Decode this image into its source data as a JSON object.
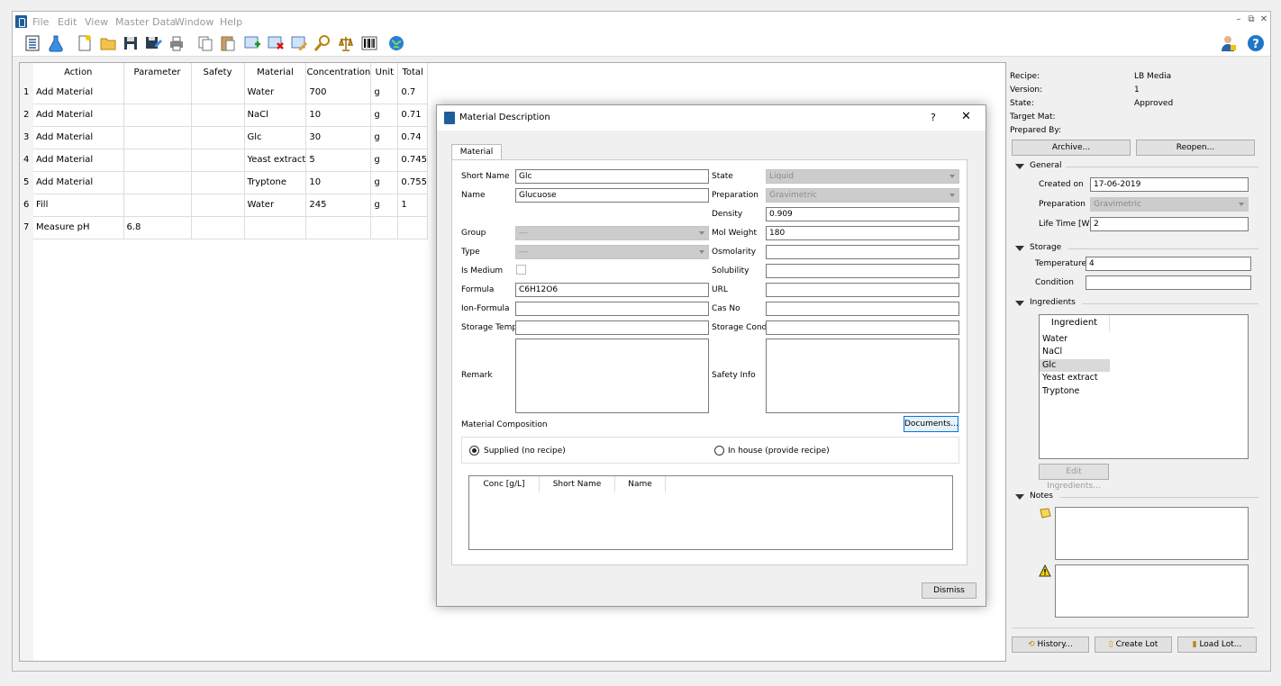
{
  "menu": [
    "File",
    "Edit",
    "View",
    "Master Data",
    "Window",
    "Help"
  ],
  "window_controls": {
    "minimize": "–",
    "restore": "⧉",
    "close": "✕"
  },
  "table": {
    "headers": [
      "Action",
      "Parameter",
      "Safety",
      "Material",
      "Concentration",
      "Unit",
      "Total"
    ],
    "rows": [
      {
        "n": "1",
        "action": "Add Material",
        "parameter": "",
        "safety": "",
        "material": "Water",
        "conc": "700",
        "unit": "g",
        "total": "0.7"
      },
      {
        "n": "2",
        "action": "Add Material",
        "parameter": "",
        "safety": "",
        "material": "NaCl",
        "conc": "10",
        "unit": "g",
        "total": "0.71"
      },
      {
        "n": "3",
        "action": "Add Material",
        "parameter": "",
        "safety": "",
        "material": "Glc",
        "conc": "30",
        "unit": "g",
        "total": "0.74"
      },
      {
        "n": "4",
        "action": "Add Material",
        "parameter": "",
        "safety": "",
        "material": "Yeast extract",
        "conc": "5",
        "unit": "g",
        "total": "0.745"
      },
      {
        "n": "5",
        "action": "Add Material",
        "parameter": "",
        "safety": "",
        "material": "Tryptone",
        "conc": "10",
        "unit": "g",
        "total": "0.755"
      },
      {
        "n": "6",
        "action": "Fill",
        "parameter": "",
        "safety": "",
        "material": "Water",
        "conc": "245",
        "unit": "g",
        "total": "1"
      },
      {
        "n": "7",
        "action": "Measure pH",
        "parameter": "6.8",
        "safety": "",
        "material": "",
        "conc": "",
        "unit": "",
        "total": ""
      }
    ]
  },
  "right_panel": {
    "recipe_label": "Recipe:",
    "recipe_value": "LB Media",
    "version_label": "Version:",
    "version_value": "1",
    "state_label": "State:",
    "state_value": "Approved",
    "target_label": "Target Mat:",
    "prepared_label": "Prepared By:",
    "archive_btn": "Archive...",
    "reopen_btn": "Reopen...",
    "general": {
      "title": "General",
      "created_label": "Created on",
      "created_value": "17-06-2019",
      "prep_label": "Preparation",
      "prep_value": "Gravimetric",
      "life_label": "Life Time [W]",
      "life_value": "2"
    },
    "storage": {
      "title": "Storage",
      "temp_label": "Temperature",
      "temp_value": "4",
      "cond_label": "Condition",
      "cond_value": ""
    },
    "ingredients": {
      "title": "Ingredients",
      "header": "Ingredient",
      "items": [
        "Water",
        "NaCl",
        "Glc",
        "Yeast extract",
        "Tryptone"
      ],
      "edit_btn": "Edit Ingredients..."
    },
    "notes": {
      "title": "Notes"
    },
    "history_btn": "History...",
    "create_lot_btn": "Create Lot",
    "load_lot_btn": "Load Lot..."
  },
  "dialog": {
    "title": "Material Description",
    "help": "?",
    "close": "✕",
    "tab": "Material",
    "short_name_label": "Short Name",
    "short_name_value": "Glc",
    "name_label": "Name",
    "name_value": "Glucuose",
    "group_label": "Group",
    "group_value": "---",
    "type_label": "Type",
    "type_value": "---",
    "is_medium_label": "Is Medium",
    "formula_label": "Formula",
    "formula_value": "C6H12O6",
    "ion_formula_label": "Ion-Formula",
    "storage_temp_label": "Storage Temp",
    "remark_label": "Remark",
    "state_label": "State",
    "state_value": "Liquid",
    "preparation_label": "Preparation",
    "preparation_value": "Gravimetric",
    "density_label": "Density",
    "density_value": "0.909",
    "mol_weight_label": "Mol Weight",
    "mol_weight_value": "180",
    "osmolarity_label": "Osmolarity",
    "solubility_label": "Solubility",
    "url_label": "URL",
    "cas_label": "Cas No",
    "storage_cond_label": "Storage Cond",
    "safety_label": "Safety Info",
    "composition_label": "Material Composition",
    "documents_btn": "Documents...",
    "radio_supplied": "Supplied (no recipe)",
    "radio_inhouse": "In house (provide recipe)",
    "comp_headers": [
      "Conc [g/L]",
      "Short Name",
      "Name"
    ],
    "dismiss_btn": "Dismiss"
  }
}
